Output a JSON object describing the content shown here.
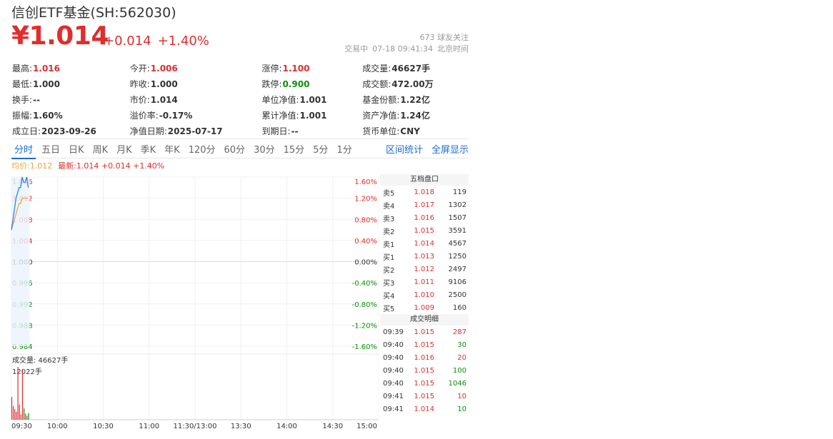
{
  "header": {
    "title": "信创ETF基金(SH:562030)",
    "price": "¥1.014",
    "change": "+0.014",
    "change_pct": "+1.40%",
    "followers": "673 球友关注",
    "status": "交易中",
    "datetime": "07-18 09:41:34",
    "timezone": "北京时间"
  },
  "stats": [
    [
      {
        "label": "最高:",
        "value": "1.016",
        "color": "up"
      },
      {
        "label": "今开:",
        "value": "1.006",
        "color": "up"
      },
      {
        "label": "涨停:",
        "value": "1.100",
        "color": "up"
      },
      {
        "label": "成交量:",
        "value": "46627手",
        "color": ""
      }
    ],
    [
      {
        "label": "最低:",
        "value": "1.000",
        "color": ""
      },
      {
        "label": "昨收:",
        "value": "1.000",
        "color": ""
      },
      {
        "label": "跌停:",
        "value": "0.900",
        "color": "down"
      },
      {
        "label": "成交额:",
        "value": "472.00万",
        "color": ""
      }
    ],
    [
      {
        "label": "换手:",
        "value": "--",
        "color": ""
      },
      {
        "label": "市价:",
        "value": "1.014",
        "color": ""
      },
      {
        "label": "单位净值:",
        "value": "1.001",
        "color": ""
      },
      {
        "label": "基金份额:",
        "value": "1.22亿",
        "color": ""
      }
    ],
    [
      {
        "label": "振幅:",
        "value": "1.60%",
        "color": ""
      },
      {
        "label": "溢价率:",
        "value": "-0.17%",
        "color": ""
      },
      {
        "label": "累计净值:",
        "value": "1.001",
        "color": ""
      },
      {
        "label": "资产净值:",
        "value": "1.24亿",
        "color": ""
      }
    ],
    [
      {
        "label": "成立日:",
        "value": "2023-09-26",
        "color": ""
      },
      {
        "label": "净值日期:",
        "value": "2025-07-17",
        "color": ""
      },
      {
        "label": "到期日:",
        "value": "--",
        "color": ""
      },
      {
        "label": "货币单位:",
        "value": "CNY",
        "color": ""
      }
    ]
  ],
  "tabs": [
    "分时",
    "五日",
    "日K",
    "周K",
    "月K",
    "季K",
    "年K",
    "120分",
    "60分",
    "30分",
    "15分",
    "5分",
    "1分"
  ],
  "tab_links": [
    "区间统计",
    "全屏显示"
  ],
  "legend": {
    "avg": "均价:1.012",
    "last": "最新:1.014 +0.014 +1.40%"
  },
  "chart_data": {
    "type": "line",
    "price_ticks": [
      "1.016",
      "1.012",
      "1.008",
      "1.004",
      "1.000",
      "0.996",
      "0.992",
      "0.988",
      "0.984"
    ],
    "pct_ticks": [
      "1.60%",
      "1.20%",
      "0.80%",
      "0.40%",
      "0.00%",
      "-0.40%",
      "-0.80%",
      "-1.20%",
      "-1.60%"
    ],
    "time_ticks": [
      "09:30",
      "10:00",
      "10:30",
      "11:00",
      "11:30/13:00",
      "13:30",
      "14:00",
      "14:30",
      "15:00"
    ],
    "ylim": [
      0.984,
      1.016
    ],
    "prev_close": 1.0,
    "minutes_total": 240,
    "price": [
      1.006,
      1.008,
      1.01,
      1.012,
      1.013,
      1.014,
      1.014,
      1.016,
      1.015,
      1.015,
      1.016,
      1.014
    ],
    "avg": [
      1.006,
      1.007,
      1.008,
      1.009,
      1.01,
      1.011,
      1.011,
      1.012,
      1.012,
      1.012,
      1.012,
      1.012
    ],
    "volume_label": "成交量: 46627手",
    "volume_max_label": "12022手",
    "volume_max": 12022,
    "volume": [
      5200,
      3100,
      2400,
      1800,
      12022,
      3500,
      1200,
      11500,
      2600,
      1400,
      900,
      1500
    ]
  },
  "order_book": {
    "title": "五档盘口",
    "asks": [
      {
        "label": "卖5",
        "price": "1.018",
        "vol": "119"
      },
      {
        "label": "卖4",
        "price": "1.017",
        "vol": "1302"
      },
      {
        "label": "卖3",
        "price": "1.016",
        "vol": "1507"
      },
      {
        "label": "卖2",
        "price": "1.015",
        "vol": "3591"
      },
      {
        "label": "卖1",
        "price": "1.014",
        "vol": "4567"
      }
    ],
    "bids": [
      {
        "label": "买1",
        "price": "1.013",
        "vol": "1250"
      },
      {
        "label": "买2",
        "price": "1.012",
        "vol": "2497"
      },
      {
        "label": "买3",
        "price": "1.011",
        "vol": "9106"
      },
      {
        "label": "买4",
        "price": "1.010",
        "vol": "2500"
      },
      {
        "label": "买5",
        "price": "1.009",
        "vol": "160"
      }
    ]
  },
  "trades": {
    "title": "成交明细",
    "rows": [
      {
        "time": "09:39",
        "price": "1.015",
        "vol": "287",
        "dir": "up"
      },
      {
        "time": "09:40",
        "price": "1.015",
        "vol": "30",
        "dir": "down"
      },
      {
        "time": "09:40",
        "price": "1.016",
        "vol": "20",
        "dir": "up"
      },
      {
        "time": "09:40",
        "price": "1.015",
        "vol": "100",
        "dir": "down"
      },
      {
        "time": "09:40",
        "price": "1.015",
        "vol": "1046",
        "dir": "down"
      },
      {
        "time": "09:41",
        "price": "1.015",
        "vol": "10",
        "dir": "up"
      },
      {
        "time": "09:41",
        "price": "1.014",
        "vol": "10",
        "dir": "down"
      }
    ]
  },
  "colors": {
    "up": "#e02d2d",
    "down": "#0a8f0a",
    "price_line": "#2f8fe8",
    "avg_line": "#e9a33a",
    "link": "#1c6ad8"
  }
}
